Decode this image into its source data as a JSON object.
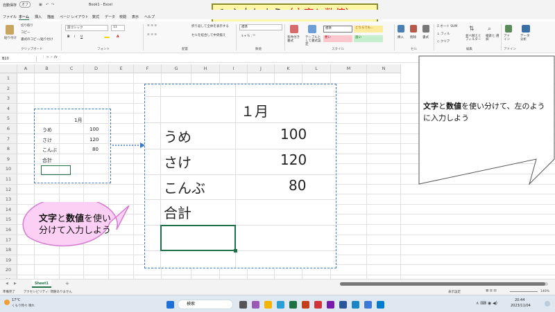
{
  "titlebar": {
    "autosave": "自動保存",
    "autosave_state": "オフ",
    "filename": "Book1 - Excel"
  },
  "tabs": [
    "ファイル",
    "ホーム",
    "挿入",
    "描画",
    "ページ レイアウト",
    "数式",
    "データ",
    "校閲",
    "表示",
    "ヘルプ"
  ],
  "active_tab": "ホーム",
  "ribbon": {
    "paste": "貼り付け",
    "cut": "切り取り",
    "copy": "コピー",
    "format_painter": "書式のコピー/貼り付け",
    "group_clipboard": "クリップボード",
    "font_name": "游ゴシック",
    "font_size": "11",
    "group_font": "フォント",
    "wrap": "折り返して全体を表示する",
    "merge": "セルを結合して中央揃え",
    "group_align": "配置",
    "number_format": "標準",
    "group_number": "数値",
    "cond_format": "条件付き書式",
    "table_format": "テーブルとして書式設定",
    "style_standard": "標準",
    "style_neutral": "どちらでも...",
    "style_bad": "悪い",
    "style_good": "良い",
    "group_style": "スタイル",
    "insert": "挿入",
    "delete": "削除",
    "format": "書式",
    "group_cells": "セル",
    "autosum": "オート SUM",
    "fill": "フィル",
    "clear": "クリア",
    "sort": "並べ替えと フィルター",
    "find": "検索と 選択",
    "group_edit": "編集",
    "addin": "アド イン",
    "group_addin": "アドイン",
    "data_analysis": "データ 分析"
  },
  "slide_title": {
    "prefix": "１ 入力しよう",
    "suffix": "（文字と数値）"
  },
  "formula_bar": {
    "namebox": "B10",
    "fx": "fx"
  },
  "columns": [
    "A",
    "B",
    "C",
    "D",
    "E",
    "F",
    "G",
    "H",
    "I",
    "J",
    "K",
    "L",
    "M",
    "N"
  ],
  "rows": [
    "1",
    "2",
    "3",
    "4",
    "5",
    "6",
    "7",
    "8",
    "9",
    "10",
    "11",
    "12",
    "13",
    "14",
    "15",
    "16",
    "17",
    "18",
    "19",
    "20",
    "21",
    "22"
  ],
  "small_table": {
    "header": "1月",
    "rows": [
      {
        "label": "うめ",
        "value": "100"
      },
      {
        "label": "さけ",
        "value": "120"
      },
      {
        "label": "こんぶ",
        "value": "80"
      },
      {
        "label": "合計",
        "value": ""
      }
    ]
  },
  "zoom_table": {
    "header": "１月",
    "rows": [
      {
        "label": "うめ",
        "value": "100"
      },
      {
        "label": "さけ",
        "value": "120"
      },
      {
        "label": "こんぶ",
        "value": "80"
      },
      {
        "label": "合計",
        "value": ""
      }
    ]
  },
  "callout_left": {
    "bold1": "文字",
    "mid": "と",
    "bold2": "数値",
    "tail": "を使い分けて入力しよう"
  },
  "callout_right": {
    "bold1": "文字",
    "mid": "と",
    "bold2": "数値",
    "tail": "を使い分けて、左のように入力しよう"
  },
  "sheet": {
    "tab": "Sheet1",
    "add": "+"
  },
  "status": {
    "ready": "準備完了",
    "accessibility": "アクセシビリティ: 問題ありません",
    "display_settings": "表示設定",
    "zoom": "140%"
  },
  "taskbar": {
    "weather_temp": "17°C",
    "weather_desc": "くもり時々 晴れ",
    "search": "検索",
    "time": "20:44",
    "date": "2023/11/04"
  }
}
